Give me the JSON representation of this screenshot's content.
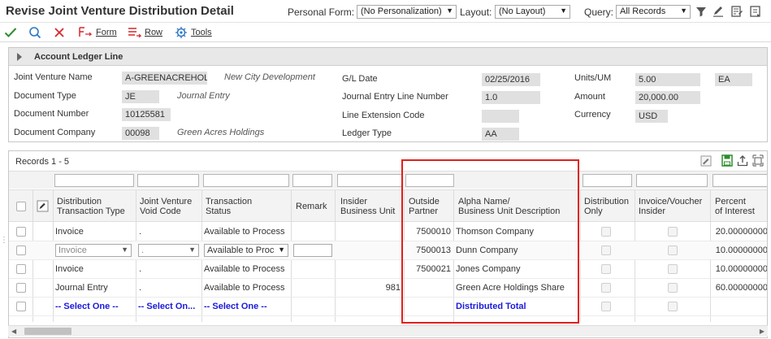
{
  "title": "Revise Joint Venture Distribution Detail",
  "header": {
    "personal_form_label": "Personal Form:",
    "personal_form_value": "(No Personalization)",
    "layout_label": "Layout:",
    "layout_value": "(No Layout)",
    "query_label": "Query:",
    "query_value": "All Records"
  },
  "toolbar": {
    "form_label": "Form",
    "row_label": "Row",
    "tools_label": "Tools"
  },
  "panel": {
    "title": "Account Ledger Line",
    "joint_venture_name_label": "Joint Venture Name",
    "joint_venture_name_value": "A-GREENACREHOL",
    "joint_venture_name_desc": "New City Development",
    "document_type_label": "Document Type",
    "document_type_value": "JE",
    "document_type_desc": "Journal Entry",
    "document_number_label": "Document Number",
    "document_number_value": "10125581",
    "document_company_label": "Document Company",
    "document_company_value": "00098",
    "document_company_desc": "Green Acres Holdings",
    "gl_date_label": "G/L Date",
    "gl_date_value": "02/25/2016",
    "je_line_label": "Journal Entry Line Number",
    "je_line_value": "1.0",
    "line_ext_label": "Line Extension Code",
    "line_ext_value": "",
    "ledger_type_label": "Ledger Type",
    "ledger_type_value": "AA",
    "units_label": "Units/UM",
    "units_value": "5.00",
    "um_value": "EA",
    "amount_label": "Amount",
    "amount_value": "20,000.00",
    "currency_label": "Currency",
    "currency_value": "USD"
  },
  "grid": {
    "records_label": "Records 1 - 5",
    "columns": {
      "dist_type": [
        "Distribution",
        "Transaction Type"
      ],
      "void_code": [
        "Joint Venture",
        "Void Code"
      ],
      "trans_status": [
        "Transaction",
        "Status"
      ],
      "remark": [
        "Remark"
      ],
      "insider_bu": [
        "Insider",
        "Business Unit"
      ],
      "outside_partner": [
        "Outside",
        "Partner"
      ],
      "alpha_name": [
        "Alpha Name/",
        "Business Unit Description"
      ],
      "dist_only": [
        "Distribution",
        "Only"
      ],
      "invoice_insider": [
        "Invoice/Voucher",
        "Insider"
      ],
      "percent_interest": [
        "Percent",
        "of Interest"
      ]
    },
    "rows": [
      {
        "dist_type": "Invoice",
        "void_code": ".",
        "trans_status": "Available to Process",
        "remark": "",
        "insider_bu": "",
        "outside_partner": "7500010",
        "alpha_name": "Thomson Company",
        "percent": "20.00000000"
      },
      {
        "dist_type": "Invoice",
        "void_code": ".",
        "trans_status": "Available to Proc",
        "remark": "",
        "insider_bu": "",
        "outside_partner": "7500013",
        "alpha_name": "Dunn Company",
        "percent": "10.00000000"
      },
      {
        "dist_type": "Invoice",
        "void_code": ".",
        "trans_status": "Available to Process",
        "remark": "",
        "insider_bu": "",
        "outside_partner": "7500021",
        "alpha_name": "Jones Company",
        "percent": "10.00000000"
      },
      {
        "dist_type": "Journal Entry",
        "void_code": ".",
        "trans_status": "Available to Process",
        "remark": "",
        "insider_bu": "981",
        "outside_partner": "",
        "alpha_name": "Green Acre Holdings Share",
        "percent": "60.00000000"
      },
      {
        "dist_type": "-- Select One --",
        "void_code": "-- Select On...",
        "trans_status": "-- Select One --",
        "remark": "",
        "insider_bu": "",
        "outside_partner": "",
        "alpha_name": "Distributed Total",
        "percent": ""
      }
    ]
  },
  "colors": {
    "highlight_box": "#e0201b",
    "link_blue": "#1a1adb",
    "ok_green": "#2e8b2e",
    "cancel_red": "#d9262c"
  }
}
